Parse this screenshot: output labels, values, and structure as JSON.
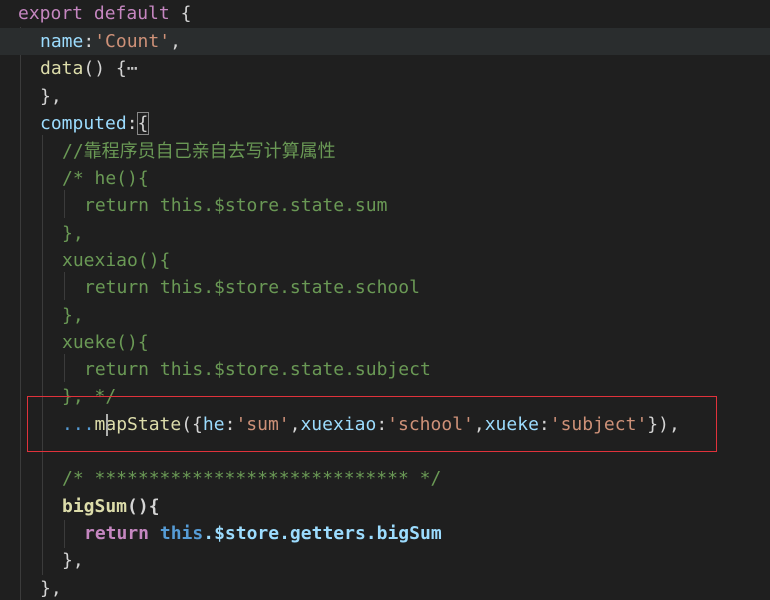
{
  "code": {
    "l1": {
      "kw": "export",
      "kw2": "default",
      "rest": " {"
    },
    "l2": {
      "prop": "name",
      "colon": ":",
      "str": "'Count'",
      "end": ","
    },
    "l3": {
      "fn": "data",
      "paren": "() {",
      "fold": "⋯"
    },
    "l4": {
      "text": "},"
    },
    "l5": {
      "prop": "computed",
      "colon": ":",
      "brace": "{"
    },
    "l6": {
      "comment": "//靠程序员自己亲自去写计算属性"
    },
    "l7": {
      "comment": "/* he(){"
    },
    "l8": {
      "comment": "return this.$store.state.sum"
    },
    "l9": {
      "comment": "},"
    },
    "l10": {
      "comment": "xuexiao(){"
    },
    "l11": {
      "comment": "return this.$store.state.school"
    },
    "l12": {
      "comment": "},"
    },
    "l13": {
      "comment": "xueke(){"
    },
    "l14": {
      "comment": "return this.$store.state.subject"
    },
    "l15": {
      "comment": "}, */"
    },
    "l16": {
      "spread": "...",
      "fn": "mapState",
      "open": "({",
      "k1": "he",
      "v1": "'sum'",
      "k2": "xuexiao",
      "v2": "'school'",
      "k3": "xueke",
      "v3": "'subject'",
      "close": "}),",
      "colon": ":",
      "comma": ","
    },
    "l17": {
      "comment": "/* ***************************** */"
    },
    "l18": {
      "fn": "bigSum",
      "paren": "(){"
    },
    "l19": {
      "kw": "return",
      "this": "this",
      "p1": ".$store",
      "p2": ".getters",
      "p3": ".bigSum"
    },
    "l20": {
      "text": "},"
    },
    "l21": {
      "text": "},"
    }
  },
  "colors": {
    "background": "#1f1f1f",
    "highlight_box": "#e0323b"
  }
}
